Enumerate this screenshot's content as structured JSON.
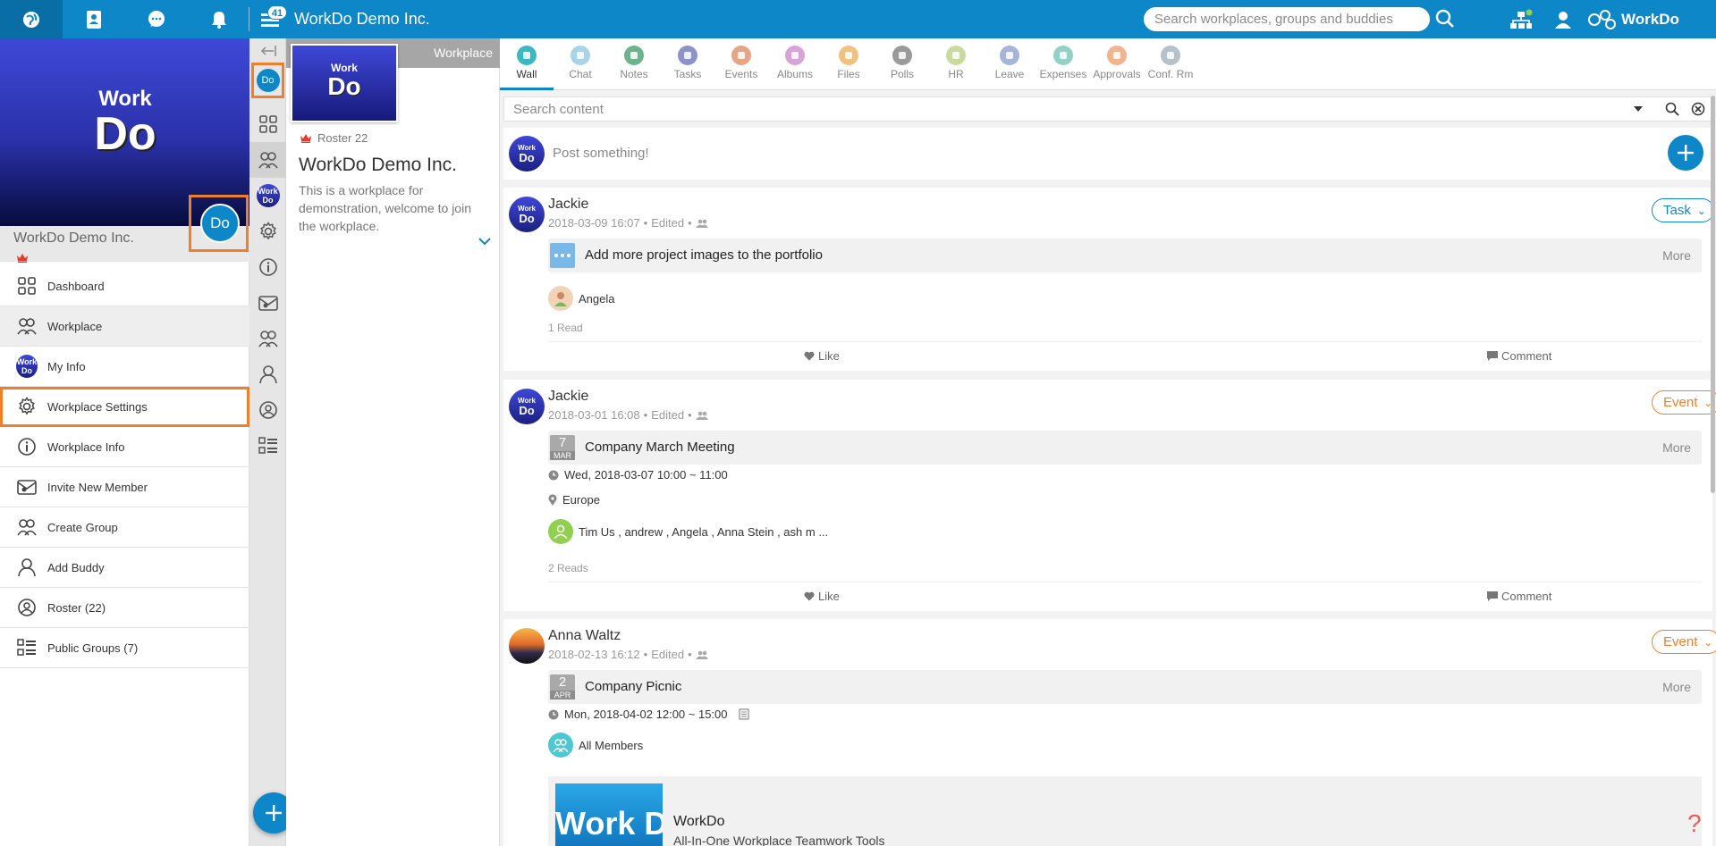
{
  "topbar": {
    "company": "WorkDo Demo Inc.",
    "feed_count": "41",
    "search_placeholder": "Search workplaces, groups and buddies",
    "logo_text": "WorkDo"
  },
  "leftpanel": {
    "logo_top": "Work",
    "logo_bottom": "Do",
    "avatar_text": "Do",
    "company": "WorkDo Demo Inc.",
    "mini_logo_top": "Work",
    "mini_logo_bottom": "Do",
    "menu": [
      {
        "label": "Dashboard",
        "icon": "grid-icon"
      },
      {
        "label": "Workplace",
        "icon": "workplace-icon"
      },
      {
        "label": "My Info",
        "icon": "avatar"
      },
      {
        "label": "Workplace Settings",
        "icon": "gear-icon"
      },
      {
        "label": "Workplace Info",
        "icon": "info-icon"
      },
      {
        "label": "Invite New Member",
        "icon": "invite-icon"
      },
      {
        "label": "Create Group",
        "icon": "group-icon"
      },
      {
        "label": "Add Buddy",
        "icon": "buddy-icon"
      },
      {
        "label": "Roster  (22)",
        "icon": "roster-icon"
      },
      {
        "label": "Public Groups  (7)",
        "icon": "list-icon"
      }
    ]
  },
  "rail": {
    "do_text": "Do"
  },
  "workplace": {
    "band_label": "Workplace",
    "logo_top": "Work",
    "logo_bottom": "Do",
    "roster": "Roster 22",
    "title": "WorkDo Demo Inc.",
    "description": "This is a workplace for demonstration, welcome to join the workplace."
  },
  "tabs": [
    {
      "label": "Wall",
      "color": "#3cb8c2"
    },
    {
      "label": "Chat",
      "color": "#a8d4ea"
    },
    {
      "label": "Notes",
      "color": "#6cb38e"
    },
    {
      "label": "Tasks",
      "color": "#8c93c9"
    },
    {
      "label": "Events",
      "color": "#e6a586"
    },
    {
      "label": "Albums",
      "color": "#d9a3d9"
    },
    {
      "label": "Files",
      "color": "#f0c27e"
    },
    {
      "label": "Polls",
      "color": "#9a9a9a"
    },
    {
      "label": "HR",
      "color": "#c9d9a0"
    },
    {
      "label": "Leave",
      "color": "#a5b4d9"
    },
    {
      "label": "Expenses",
      "color": "#93d1c6"
    },
    {
      "label": "Approvals",
      "color": "#f2b48f"
    },
    {
      "label": "Conf. Rm",
      "color": "#b5c2cc"
    }
  ],
  "search": {
    "placeholder": "Search content"
  },
  "composer": {
    "placeholder": "Post something!",
    "avatar_top": "Work",
    "avatar_bottom": "Do"
  },
  "posts": [
    {
      "author": "Jackie",
      "date": "2018-03-09 16:07",
      "edited": "Edited",
      "badge": "Task",
      "title": "Add more project images to the portfolio",
      "more": "More",
      "assignee": "Angela",
      "reads": "1 Read",
      "like": "Like",
      "comment": "Comment",
      "avatar_top": "Work",
      "avatar_bottom": "Do"
    },
    {
      "author": "Jackie",
      "date": "2018-03-01 16:08",
      "edited": "Edited",
      "badge": "Event",
      "cal_day": "7",
      "cal_month": "MAR",
      "title": "Company March Meeting",
      "more": "More",
      "time": "Wed, 2018-03-07 10:00 ~ 11:00",
      "location": "Europe",
      "attendees": "Tim Us , andrew , Angela , Anna Stein , ash m ...",
      "reads": "2 Reads",
      "like": "Like",
      "comment": "Comment",
      "avatar_top": "Work",
      "avatar_bottom": "Do"
    },
    {
      "author": "Anna Waltz",
      "date": "2018-02-13 16:12",
      "edited": "Edited",
      "badge": "Event",
      "cal_day": "2",
      "cal_month": "APR",
      "title": "Company Picnic",
      "more": "More",
      "time": "Mon, 2018-04-02 12:00 ~ 15:00",
      "attendees": "All Members",
      "link_image_text": "Work Do",
      "link_title": "WorkDo",
      "link_desc": "All-In-One Workplace Teamwork Tools"
    }
  ],
  "help": "?"
}
